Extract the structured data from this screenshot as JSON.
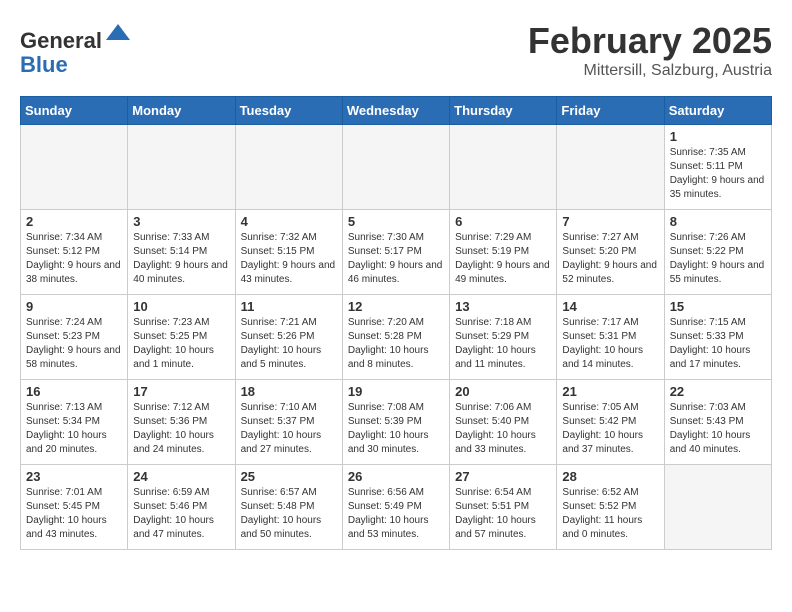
{
  "header": {
    "logo_general": "General",
    "logo_blue": "Blue",
    "month_title": "February 2025",
    "location": "Mittersill, Salzburg, Austria"
  },
  "days_of_week": [
    "Sunday",
    "Monday",
    "Tuesday",
    "Wednesday",
    "Thursday",
    "Friday",
    "Saturday"
  ],
  "weeks": [
    [
      {
        "day": "",
        "info": ""
      },
      {
        "day": "",
        "info": ""
      },
      {
        "day": "",
        "info": ""
      },
      {
        "day": "",
        "info": ""
      },
      {
        "day": "",
        "info": ""
      },
      {
        "day": "",
        "info": ""
      },
      {
        "day": "1",
        "info": "Sunrise: 7:35 AM\nSunset: 5:11 PM\nDaylight: 9 hours and 35 minutes."
      }
    ],
    [
      {
        "day": "2",
        "info": "Sunrise: 7:34 AM\nSunset: 5:12 PM\nDaylight: 9 hours and 38 minutes."
      },
      {
        "day": "3",
        "info": "Sunrise: 7:33 AM\nSunset: 5:14 PM\nDaylight: 9 hours and 40 minutes."
      },
      {
        "day": "4",
        "info": "Sunrise: 7:32 AM\nSunset: 5:15 PM\nDaylight: 9 hours and 43 minutes."
      },
      {
        "day": "5",
        "info": "Sunrise: 7:30 AM\nSunset: 5:17 PM\nDaylight: 9 hours and 46 minutes."
      },
      {
        "day": "6",
        "info": "Sunrise: 7:29 AM\nSunset: 5:19 PM\nDaylight: 9 hours and 49 minutes."
      },
      {
        "day": "7",
        "info": "Sunrise: 7:27 AM\nSunset: 5:20 PM\nDaylight: 9 hours and 52 minutes."
      },
      {
        "day": "8",
        "info": "Sunrise: 7:26 AM\nSunset: 5:22 PM\nDaylight: 9 hours and 55 minutes."
      }
    ],
    [
      {
        "day": "9",
        "info": "Sunrise: 7:24 AM\nSunset: 5:23 PM\nDaylight: 9 hours and 58 minutes."
      },
      {
        "day": "10",
        "info": "Sunrise: 7:23 AM\nSunset: 5:25 PM\nDaylight: 10 hours and 1 minute."
      },
      {
        "day": "11",
        "info": "Sunrise: 7:21 AM\nSunset: 5:26 PM\nDaylight: 10 hours and 5 minutes."
      },
      {
        "day": "12",
        "info": "Sunrise: 7:20 AM\nSunset: 5:28 PM\nDaylight: 10 hours and 8 minutes."
      },
      {
        "day": "13",
        "info": "Sunrise: 7:18 AM\nSunset: 5:29 PM\nDaylight: 10 hours and 11 minutes."
      },
      {
        "day": "14",
        "info": "Sunrise: 7:17 AM\nSunset: 5:31 PM\nDaylight: 10 hours and 14 minutes."
      },
      {
        "day": "15",
        "info": "Sunrise: 7:15 AM\nSunset: 5:33 PM\nDaylight: 10 hours and 17 minutes."
      }
    ],
    [
      {
        "day": "16",
        "info": "Sunrise: 7:13 AM\nSunset: 5:34 PM\nDaylight: 10 hours and 20 minutes."
      },
      {
        "day": "17",
        "info": "Sunrise: 7:12 AM\nSunset: 5:36 PM\nDaylight: 10 hours and 24 minutes."
      },
      {
        "day": "18",
        "info": "Sunrise: 7:10 AM\nSunset: 5:37 PM\nDaylight: 10 hours and 27 minutes."
      },
      {
        "day": "19",
        "info": "Sunrise: 7:08 AM\nSunset: 5:39 PM\nDaylight: 10 hours and 30 minutes."
      },
      {
        "day": "20",
        "info": "Sunrise: 7:06 AM\nSunset: 5:40 PM\nDaylight: 10 hours and 33 minutes."
      },
      {
        "day": "21",
        "info": "Sunrise: 7:05 AM\nSunset: 5:42 PM\nDaylight: 10 hours and 37 minutes."
      },
      {
        "day": "22",
        "info": "Sunrise: 7:03 AM\nSunset: 5:43 PM\nDaylight: 10 hours and 40 minutes."
      }
    ],
    [
      {
        "day": "23",
        "info": "Sunrise: 7:01 AM\nSunset: 5:45 PM\nDaylight: 10 hours and 43 minutes."
      },
      {
        "day": "24",
        "info": "Sunrise: 6:59 AM\nSunset: 5:46 PM\nDaylight: 10 hours and 47 minutes."
      },
      {
        "day": "25",
        "info": "Sunrise: 6:57 AM\nSunset: 5:48 PM\nDaylight: 10 hours and 50 minutes."
      },
      {
        "day": "26",
        "info": "Sunrise: 6:56 AM\nSunset: 5:49 PM\nDaylight: 10 hours and 53 minutes."
      },
      {
        "day": "27",
        "info": "Sunrise: 6:54 AM\nSunset: 5:51 PM\nDaylight: 10 hours and 57 minutes."
      },
      {
        "day": "28",
        "info": "Sunrise: 6:52 AM\nSunset: 5:52 PM\nDaylight: 11 hours and 0 minutes."
      },
      {
        "day": "",
        "info": ""
      }
    ]
  ]
}
